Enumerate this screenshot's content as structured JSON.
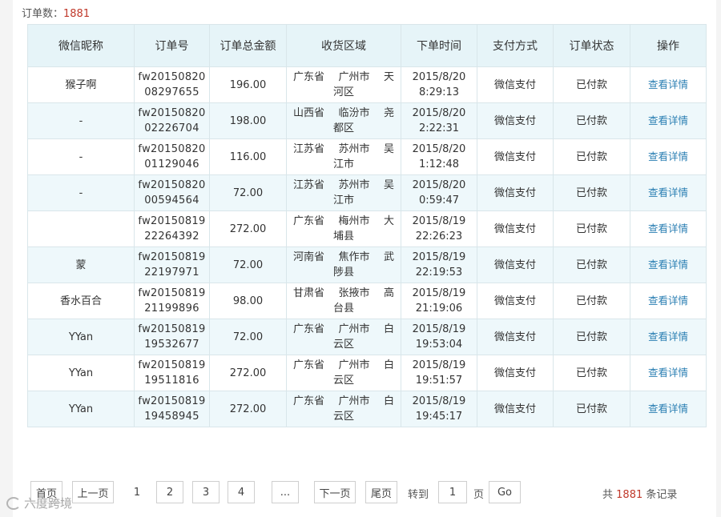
{
  "header": {
    "count_label": "订单数：",
    "count_value": "1881"
  },
  "table": {
    "columns": [
      "微信昵称",
      "订单号",
      "订单总金额",
      "收货区域",
      "下单时间",
      "支付方式",
      "订单状态",
      "操作"
    ],
    "rows": [
      {
        "nick": "猴子啊",
        "order_no_1": "fw20150820",
        "order_no_2": "08297655",
        "amount": "196.00",
        "province": "广东省",
        "city": "广州市",
        "district_1": "天",
        "district_2": "河区",
        "date": "2015/8/20",
        "time": "8:29:13",
        "pay": "微信支付",
        "status": "已付款",
        "action": "查看详情"
      },
      {
        "nick": "-",
        "order_no_1": "fw20150820",
        "order_no_2": "02226704",
        "amount": "198.00",
        "province": "山西省",
        "city": "临汾市",
        "district_1": "尧",
        "district_2": "都区",
        "date": "2015/8/20",
        "time": "2:22:31",
        "pay": "微信支付",
        "status": "已付款",
        "action": "查看详情"
      },
      {
        "nick": "-",
        "order_no_1": "fw20150820",
        "order_no_2": "01129046",
        "amount": "116.00",
        "province": "江苏省",
        "city": "苏州市",
        "district_1": "吴",
        "district_2": "江市",
        "date": "2015/8/20",
        "time": "1:12:48",
        "pay": "微信支付",
        "status": "已付款",
        "action": "查看详情"
      },
      {
        "nick": "-",
        "order_no_1": "fw20150820",
        "order_no_2": "00594564",
        "amount": "72.00",
        "province": "江苏省",
        "city": "苏州市",
        "district_1": "吴",
        "district_2": "江市",
        "date": "2015/8/20",
        "time": "0:59:47",
        "pay": "微信支付",
        "status": "已付款",
        "action": "查看详情"
      },
      {
        "nick": "",
        "order_no_1": "fw20150819",
        "order_no_2": "22264392",
        "amount": "272.00",
        "province": "广东省",
        "city": "梅州市",
        "district_1": "大",
        "district_2": "埔县",
        "date": "2015/8/19",
        "time": "22:26:23",
        "pay": "微信支付",
        "status": "已付款",
        "action": "查看详情"
      },
      {
        "nick": "蒙",
        "order_no_1": "fw20150819",
        "order_no_2": "22197971",
        "amount": "72.00",
        "province": "河南省",
        "city": "焦作市",
        "district_1": "武",
        "district_2": "陟县",
        "date": "2015/8/19",
        "time": "22:19:53",
        "pay": "微信支付",
        "status": "已付款",
        "action": "查看详情"
      },
      {
        "nick": "香水百合",
        "order_no_1": "fw20150819",
        "order_no_2": "21199896",
        "amount": "98.00",
        "province": "甘肃省",
        "city": "张掖市",
        "district_1": "高",
        "district_2": "台县",
        "date": "2015/8/19",
        "time": "21:19:06",
        "pay": "微信支付",
        "status": "已付款",
        "action": "查看详情"
      },
      {
        "nick": "YYan",
        "order_no_1": "fw20150819",
        "order_no_2": "19532677",
        "amount": "72.00",
        "province": "广东省",
        "city": "广州市",
        "district_1": "白",
        "district_2": "云区",
        "date": "2015/8/19",
        "time": "19:53:04",
        "pay": "微信支付",
        "status": "已付款",
        "action": "查看详情"
      },
      {
        "nick": "YYan",
        "order_no_1": "fw20150819",
        "order_no_2": "19511816",
        "amount": "272.00",
        "province": "广东省",
        "city": "广州市",
        "district_1": "白",
        "district_2": "云区",
        "date": "2015/8/19",
        "time": "19:51:57",
        "pay": "微信支付",
        "status": "已付款",
        "action": "查看详情"
      },
      {
        "nick": "YYan",
        "order_no_1": "fw20150819",
        "order_no_2": "19458945",
        "amount": "272.00",
        "province": "广东省",
        "city": "广州市",
        "district_1": "白",
        "district_2": "云区",
        "date": "2015/8/19",
        "time": "19:45:17",
        "pay": "微信支付",
        "status": "已付款",
        "action": "查看详情"
      }
    ]
  },
  "pager": {
    "first": "首页",
    "prev": "上一页",
    "pages": [
      "1",
      "2",
      "3",
      "4"
    ],
    "current": "1",
    "ellipsis": "...",
    "next": "下一页",
    "last": "尾页",
    "goto_label": "转到",
    "goto_value": "1",
    "goto_unit": "页",
    "go": "Go",
    "total_prefix": "共",
    "total_value": "1881",
    "total_suffix": "条记录"
  },
  "watermark": {
    "text": "六度跨境"
  },
  "colors": {
    "accent_red": "#c0392b",
    "link_blue": "#2b7fb3",
    "header_bg": "#e6f4f8",
    "stripe_bg": "#eef8fb"
  }
}
